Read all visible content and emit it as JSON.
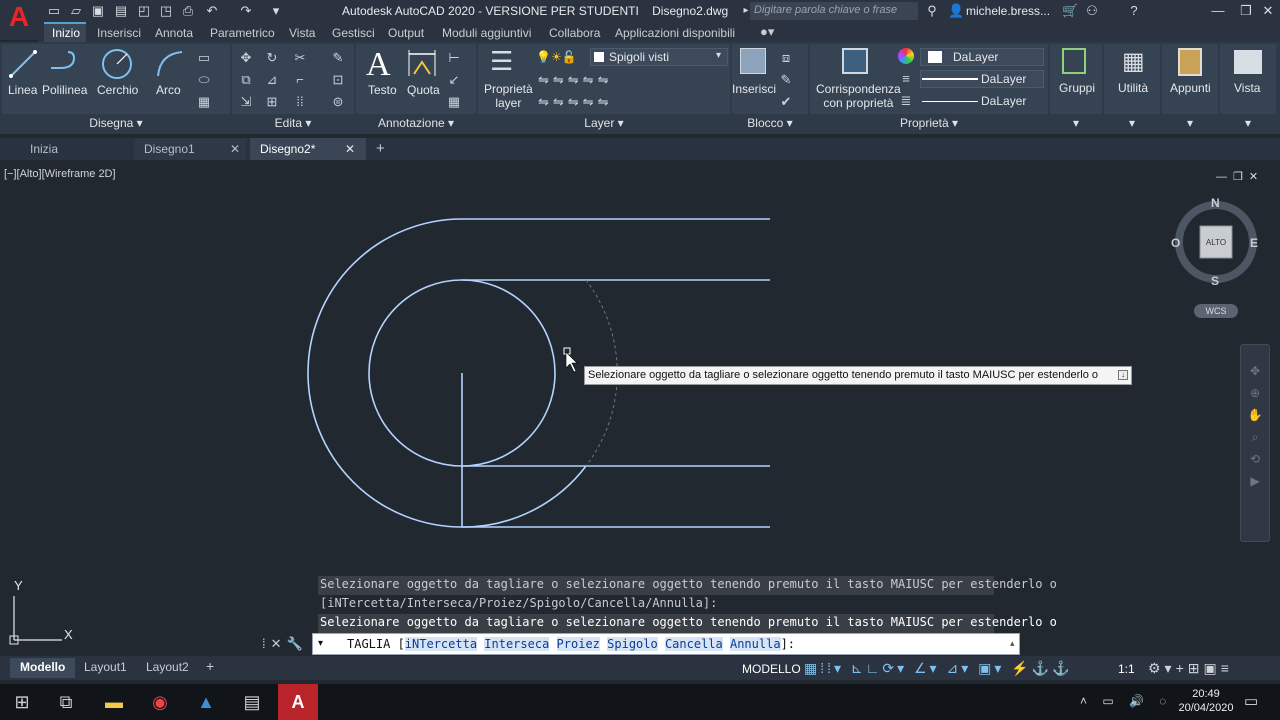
{
  "app": {
    "title": "Autodesk AutoCAD 2020 - VERSIONE PER STUDENTI",
    "document": "Disegno2.dwg",
    "search_placeholder": "Digitare parola chiave o frase",
    "user": "michele.bress...",
    "logo": "A"
  },
  "menu_tabs": [
    "Inizio",
    "Inserisci",
    "Annota",
    "Parametrico",
    "Vista",
    "Gestisci",
    "Output",
    "Moduli aggiuntivi",
    "Collabora",
    "Applicazioni disponibili"
  ],
  "ribbon": {
    "draw": {
      "label": "Disegna",
      "buttons": [
        "Linea",
        "Polilinea",
        "Cerchio",
        "Arco"
      ]
    },
    "edit": {
      "label": "Edita"
    },
    "annotation": {
      "label": "Annotazione",
      "buttons": [
        "Testo",
        "Quota"
      ]
    },
    "layer": {
      "label": "Layer",
      "button_line1": "Proprietà",
      "button_line2": "layer",
      "current": "Spigoli visti"
    },
    "block": {
      "label": "Blocco",
      "button": "Inserisci"
    },
    "properties": {
      "label": "Proprietà",
      "match_line1": "Corrispondenza",
      "match_line2": "con proprietà",
      "color": "DaLayer",
      "linetype": "DaLayer",
      "lineweight": "DaLayer"
    },
    "groups": "Gruppi",
    "utility": "Utilità",
    "clipboard": "Appunti",
    "view": "Vista"
  },
  "doc_tabs": [
    "Inizia",
    "Disegno1",
    "Disegno2*"
  ],
  "viewport": {
    "label": "[−][Alto][Wireframe 2D]",
    "viewcube": {
      "n": "N",
      "s": "S",
      "e": "E",
      "w": "O",
      "face": "ALTO",
      "wcs": "WCS"
    }
  },
  "tooltip": "Selezionare oggetto da tagliare o selezionare oggetto tenendo premuto il tasto MAIUSC per estenderlo o",
  "command": {
    "history": [
      "Selezionare oggetto da tagliare o selezionare oggetto tenendo premuto il tasto MAIUSC per estenderlo o",
      "[iNTercetta/Interseca/Proiez/Spigolo/Cancella/Annulla]:",
      "Selezionare oggetto da tagliare o selezionare oggetto tenendo premuto il tasto MAIUSC per estenderlo o"
    ],
    "prompt": "TAGLIA [",
    "options": [
      "iNTercetta",
      "Interseca",
      "Proiez",
      "Spigolo",
      "Cancella",
      "Annulla"
    ],
    "suffix": "]:"
  },
  "ucs": {
    "y": "Y",
    "x": "X"
  },
  "layout_tabs": [
    "Modello",
    "Layout1",
    "Layout2"
  ],
  "status": {
    "space": "MODELLO",
    "scale": "1:1"
  },
  "clock": {
    "time": "20:49",
    "date": "20/04/2020"
  },
  "colors": {
    "accent": "#5a9fd4",
    "canvas": "#212830",
    "geometry": "#b5d3ff"
  }
}
